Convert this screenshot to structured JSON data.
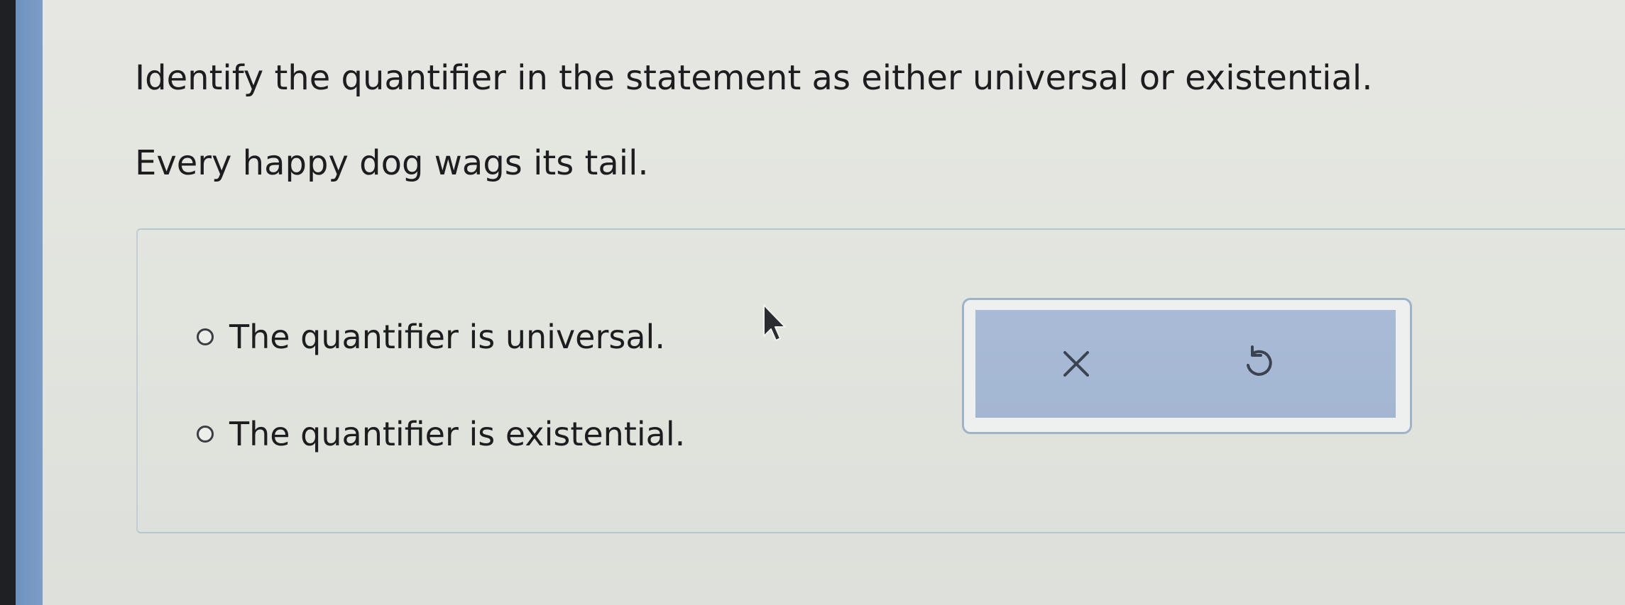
{
  "question": {
    "prompt": "Identify the quantifier in the statement as either universal or existential.",
    "statement": "Every happy dog wags its tail."
  },
  "options": [
    {
      "label": "The quantifier is universal.",
      "selected": false
    },
    {
      "label": "The quantifier is existential.",
      "selected": false
    }
  ],
  "toolbar": {
    "buttons": [
      {
        "icon": "close-icon"
      },
      {
        "icon": "undo-icon"
      }
    ]
  },
  "colors": {
    "sidebar_accent": "#7d9dc6",
    "toolbar_fill": "#a9bbd6",
    "toolbar_border": "#9eb3c8",
    "background": "#e4e6e0"
  }
}
